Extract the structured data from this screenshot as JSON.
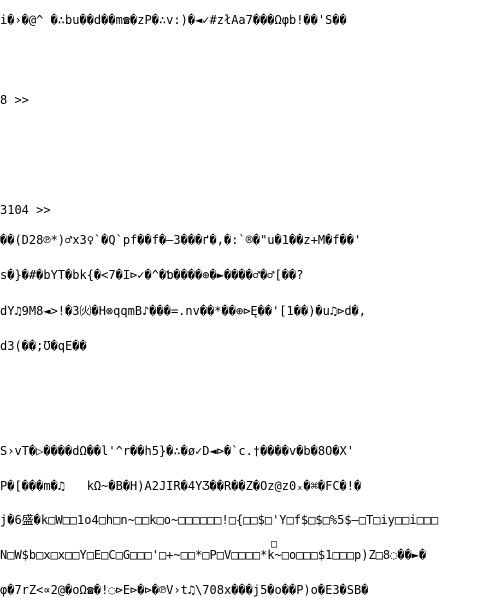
{
  "lines": [
    "\u0000\u0000\u0000",
    "8 >>",
    "3104 >>",
    "\u0000\u0000\u0000",
    "\u0000\u0000\u0000"
  ],
  "text": {
    "l01": "i�›�@^ �∴bu��d��m☎�zP�∴v:)�◄✓#złAa7���Ωφb!��'S��",
    "l02": "8 >>",
    "l03": "3104 >>",
    "l04": "��(D28℗*)♂x3♀`�Q`pf��f�–3���ґ�,�:`®�\"u�1��z+M�f��'",
    "l05": "s�}�#�bYT�bk{�<7�I⊳✓�^�ƅ����⊕�►����♂�♂[��?",
    "l06": "dY♫9M8◄>!�3㈫�H⊗qqmB♪���=.nv��*��⊕⊳Ę��'[1��)�u♫⊳d�,",
    "l07": "d3(��;Ʊ�qE��",
    "l08": "S›vT�▷����dΩ��l'^r��h5}�∴�ø✓D◄⊳�`ϲ.†����v�b�8O�X'",
    "l09": "P�[���m�♫   kΩ~�B�H)A2JIR�4YƷ��R��Z�Oz@z0ₓ�⌘�FC�!�",
    "l10": "j�6盛�k□W□□1o4□h□n~□□k□o~□□□□□□!□{□□$□'Y□f$□$□%5$–□T□iy□□i□□□",
    "l11": "N□W$b□x□x□□Y□E□C□G□□□'□+~□□*□P□V□□□□*k~□o□□□$1□□□p)Z□8◌��►�",
    "l12": "φ�7rZ<∝2@�oΩ☎�!◌⊳E⊳�⊳�℗V›t♫\\708x���j5�o��P)o�E3�SB�",
    "cursor": "□"
  }
}
